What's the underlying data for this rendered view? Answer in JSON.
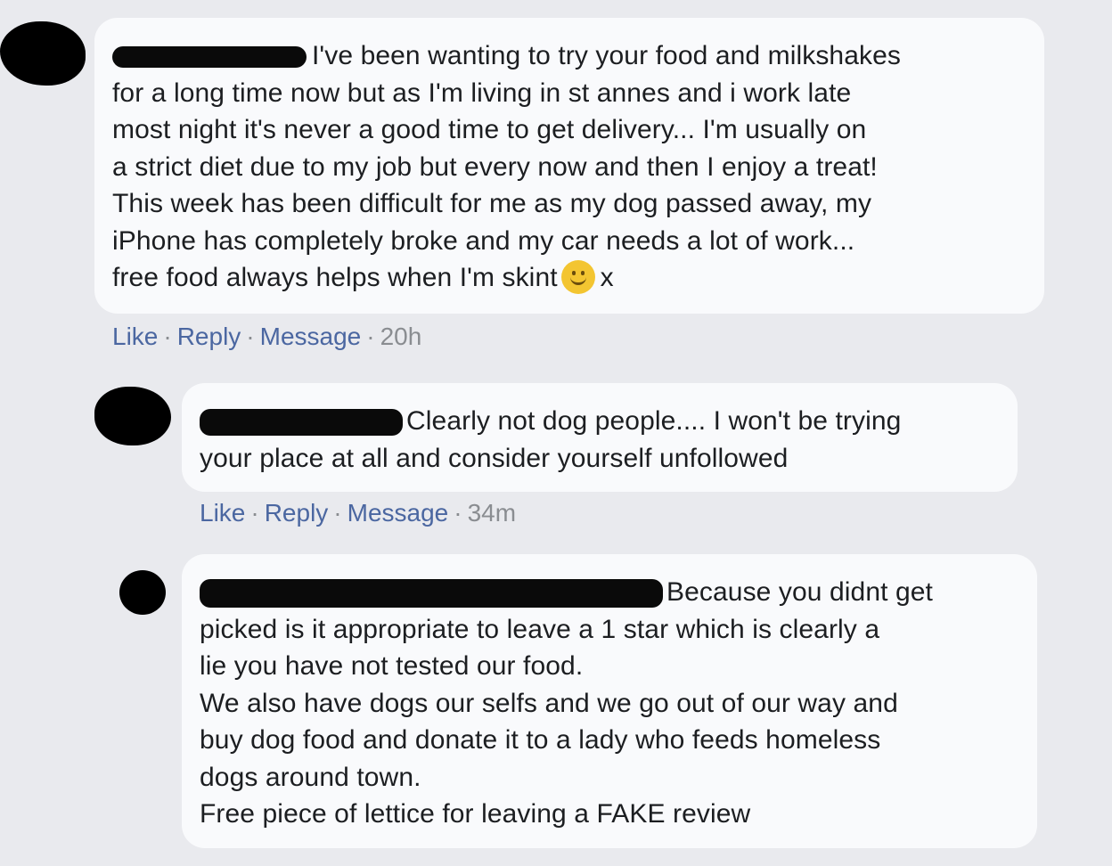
{
  "comments": [
    {
      "lines": [
        "I've been wanting to try your food and milkshakes",
        "for a long time now but as I'm living in st annes and i work late",
        "most night it's never a good time to get delivery... I'm usually on",
        "a strict diet due to my job but every now and then I enjoy a treat!",
        "This week has been difficult for me as my dog passed away, my",
        "iPhone has completely broke and my car needs a lot of work...",
        "free food always helps when I'm skint"
      ],
      "trailing_text": "x",
      "emoji": "smiley-emoji",
      "actions": {
        "like": "Like",
        "reply": "Reply",
        "message": "Message",
        "time": "20h"
      }
    },
    {
      "lines": [
        "Clearly not dog people.... I won't be trying",
        "your place at all and consider yourself unfollowed"
      ],
      "actions": {
        "like": "Like",
        "reply": "Reply",
        "message": "Message",
        "time": "34m"
      }
    },
    {
      "lines": [
        "Because you didnt get",
        "picked is it appropriate to leave a 1 star which is clearly a",
        "lie you have not tested our food.",
        "We also have dogs our selfs and we go out of our way and",
        "buy dog food and donate it to a lady who feeds homeless",
        "dogs around town.",
        "Free piece of lettice for leaving a FAKE review"
      ]
    }
  ],
  "separator": "·",
  "colors": {
    "background": "#e9eaee",
    "bubble": "#f9fafc",
    "link": "#4b67a1",
    "meta": "#8a8d91",
    "redaction": "#000000"
  }
}
